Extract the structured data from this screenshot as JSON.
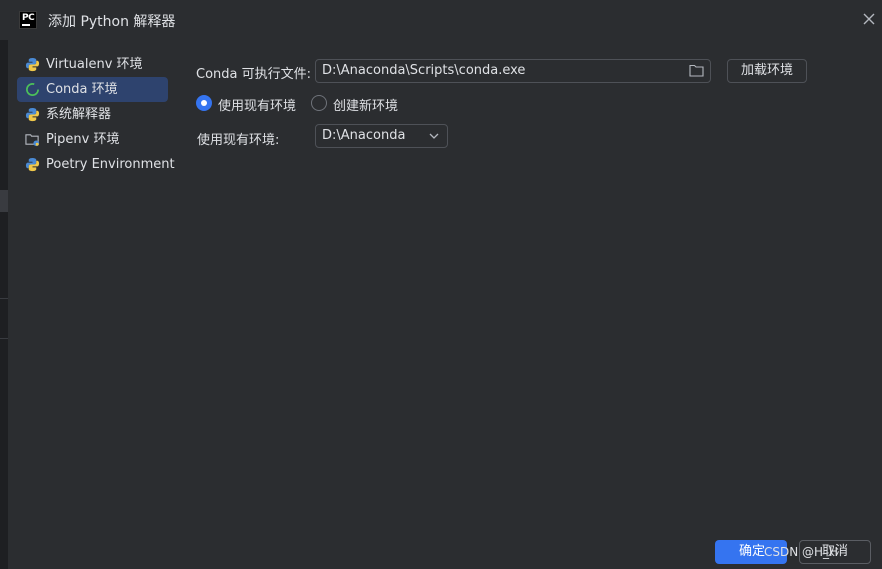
{
  "window": {
    "title": "添加 Python 解释器",
    "logo_text": "PC"
  },
  "sidebar": {
    "items": [
      {
        "label": "Virtualenv 环境",
        "icon": "python-icon",
        "selected": false
      },
      {
        "label": "Conda 环境",
        "icon": "conda-ring-icon",
        "selected": true
      },
      {
        "label": "系统解释器",
        "icon": "python-icon",
        "selected": false
      },
      {
        "label": "Pipenv 环境",
        "icon": "folder-python-icon",
        "selected": false
      },
      {
        "label": "Poetry Environment",
        "icon": "python-icon",
        "selected": false
      }
    ]
  },
  "main": {
    "conda_exe_label": "Conda 可执行文件:",
    "conda_exe_value": "D:\\Anaconda\\Scripts\\conda.exe",
    "load_env_button": "加载环境",
    "radio_existing": "使用现有环境",
    "radio_new": "创建新环境",
    "existing_env_label": "使用现有环境:",
    "existing_env_value": "D:\\Anaconda"
  },
  "footer": {
    "ok_button": "确定",
    "cancel_button": "取消",
    "watermark": "CSDN @H_H"
  },
  "colors": {
    "background": "#2b2d30",
    "accent": "#3574f0",
    "selected_item": "#2e436e"
  }
}
